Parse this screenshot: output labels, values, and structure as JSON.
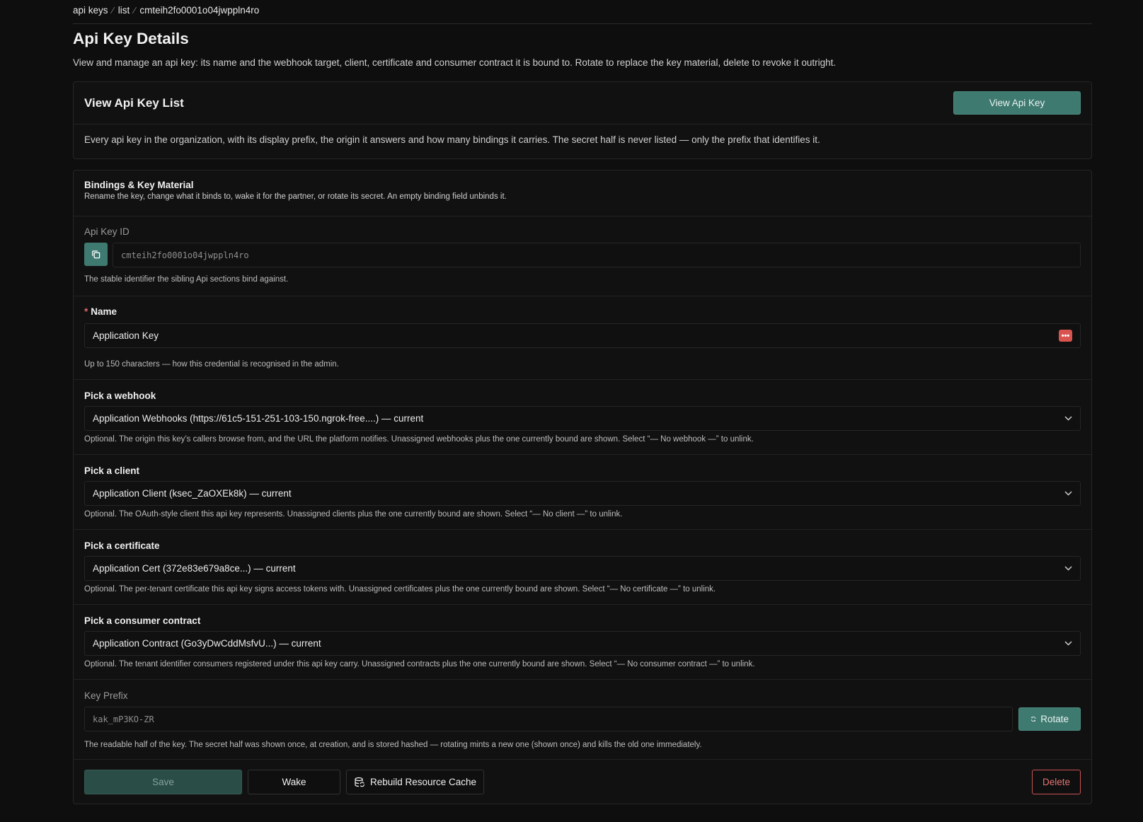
{
  "breadcrumb": [
    "api keys",
    "list",
    "cmteih2fo0001o04jwppln4ro"
  ],
  "page": {
    "title": "Api Key Details",
    "description": "View and manage an api key: its name and the webhook target, client, certificate and consumer contract it is bound to. Rotate to replace the key material, delete to revoke it outright."
  },
  "list_card": {
    "title": "View Api Key List",
    "button": "View Api Key",
    "description": "Every api key in the organization, with its display prefix, the origin it answers and how many bindings it carries. The secret half is never listed — only the prefix that identifies it."
  },
  "bindings": {
    "title": "Bindings & Key Material",
    "subtitle": "Rename the key, change what it binds to, wake it for the partner, or rotate its secret. An empty binding field unbinds it."
  },
  "api_key_id": {
    "label": "Api Key ID",
    "value": "cmteih2fo0001o04jwppln4ro",
    "help": "The stable identifier the sibling Api sections bind against."
  },
  "name": {
    "required_mark": "*",
    "label": "Name",
    "value": "Application Key",
    "badge": "•••",
    "help": "Up to 150 characters — how this credential is recognised in the admin."
  },
  "selects": [
    {
      "label": "Pick a webhook",
      "value": "Application Webhooks (https://61c5-151-251-103-150.ngrok-free....) — current",
      "help": "Optional. The origin this key’s callers browse from, and the URL the platform notifies. Unassigned webhooks plus the one currently bound are shown. Select “— No webhook —” to unlink."
    },
    {
      "label": "Pick a client",
      "value": "Application Client (ksec_ZaOXEk8k) — current",
      "help": "Optional. The OAuth-style client this api key represents. Unassigned clients plus the one currently bound are shown. Select “— No client —” to unlink."
    },
    {
      "label": "Pick a certificate",
      "value": "Application Cert (372e83e679a8ce...) — current",
      "help": "Optional. The per-tenant certificate this api key signs access tokens with. Unassigned certificates plus the one currently bound are shown. Select “— No certificate —” to unlink."
    },
    {
      "label": "Pick a consumer contract",
      "value": "Application Contract (Go3yDwCddMsfvU...) — current",
      "help": "Optional. The tenant identifier consumers registered under this api key carry. Unassigned contracts plus the one currently bound are shown. Select “— No consumer contract —” to unlink."
    }
  ],
  "key_prefix": {
    "label": "Key Prefix",
    "value": "kak_mP3KO-ZR",
    "rotate_label": "Rotate",
    "help": "The readable half of the key. The secret half was shown once, at creation, and is stored hashed — rotating mints a new one (shown once) and kills the old one immediately."
  },
  "actions": {
    "save": "Save",
    "wake": "Wake",
    "rebuild": "Rebuild Resource Cache",
    "delete": "Delete"
  },
  "colors": {
    "accent": "#3f7a70",
    "danger": "#d9534f",
    "background": "#0e0e0e"
  }
}
